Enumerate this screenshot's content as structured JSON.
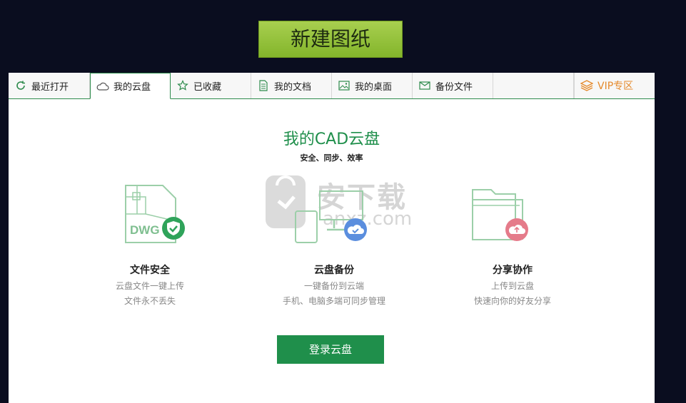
{
  "toolbar": {
    "new_drawing_label": "新建图纸"
  },
  "tabs": [
    {
      "label": "最近打开",
      "icon": "refresh-icon"
    },
    {
      "label": "我的云盘",
      "icon": "cloud-icon"
    },
    {
      "label": "已收藏",
      "icon": "star-icon"
    },
    {
      "label": "我的文档",
      "icon": "document-icon"
    },
    {
      "label": "我的桌面",
      "icon": "desktop-image-icon"
    },
    {
      "label": "备份文件",
      "icon": "mail-icon"
    },
    {
      "label": "",
      "icon": ""
    },
    {
      "label": "VIP专区",
      "icon": "vip-layers-icon"
    }
  ],
  "active_tab": "我的云盘",
  "cloud": {
    "title": "我的CAD云盘",
    "subtitle": "安全、同步、效率",
    "features": [
      {
        "title": "文件安全",
        "lines": [
          "云盘文件一键上传",
          "文件永不丢失"
        ],
        "icon": "dwg-shield-icon"
      },
      {
        "title": "云盘备份",
        "lines": [
          "一键备份到云端",
          "手机、电脑多端可同步管理"
        ],
        "icon": "devices-cloud-icon"
      },
      {
        "title": "分享协作",
        "lines": [
          "上传到云盘",
          "快速向你的好友分享"
        ],
        "icon": "folder-share-icon"
      }
    ],
    "login_label": "登录云盘"
  },
  "watermark": {
    "text": "安下载",
    "sub": "anxz.com"
  },
  "colors": {
    "accent": "#1f8f4b",
    "new_button": "#96c43d",
    "vip": "#e58a2c",
    "background": "#0a0d1f"
  }
}
